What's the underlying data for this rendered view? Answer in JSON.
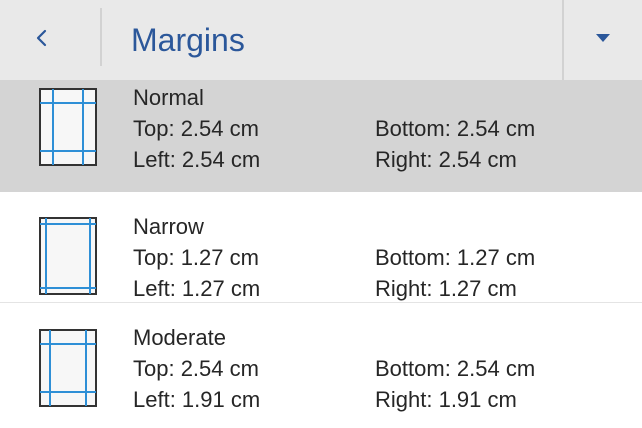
{
  "header": {
    "title": "Margins",
    "back_icon": "chevron-left-icon",
    "dropdown_icon": "caret-down-icon",
    "accent_color": "#2b579a"
  },
  "options": [
    {
      "name": "Normal",
      "top": "Top: 2.54 cm",
      "bottom": "Bottom: 2.54 cm",
      "left": "Left: 2.54 cm",
      "right": "Right: 2.54 cm",
      "selected": true
    },
    {
      "name": "Narrow",
      "top": "Top: 1.27 cm",
      "bottom": "Bottom: 1.27 cm",
      "left": "Left: 1.27 cm",
      "right": "Right: 1.27 cm",
      "selected": false
    },
    {
      "name": "Moderate",
      "top": "Top: 2.54 cm",
      "bottom": "Bottom: 2.54 cm",
      "left": "Left: 1.91 cm",
      "right": "Right: 1.91 cm",
      "selected": false
    }
  ],
  "colors": {
    "guide_line": "#2e8fd6",
    "header_bg": "#e9e9e9",
    "selected_bg": "#d4d4d4"
  }
}
